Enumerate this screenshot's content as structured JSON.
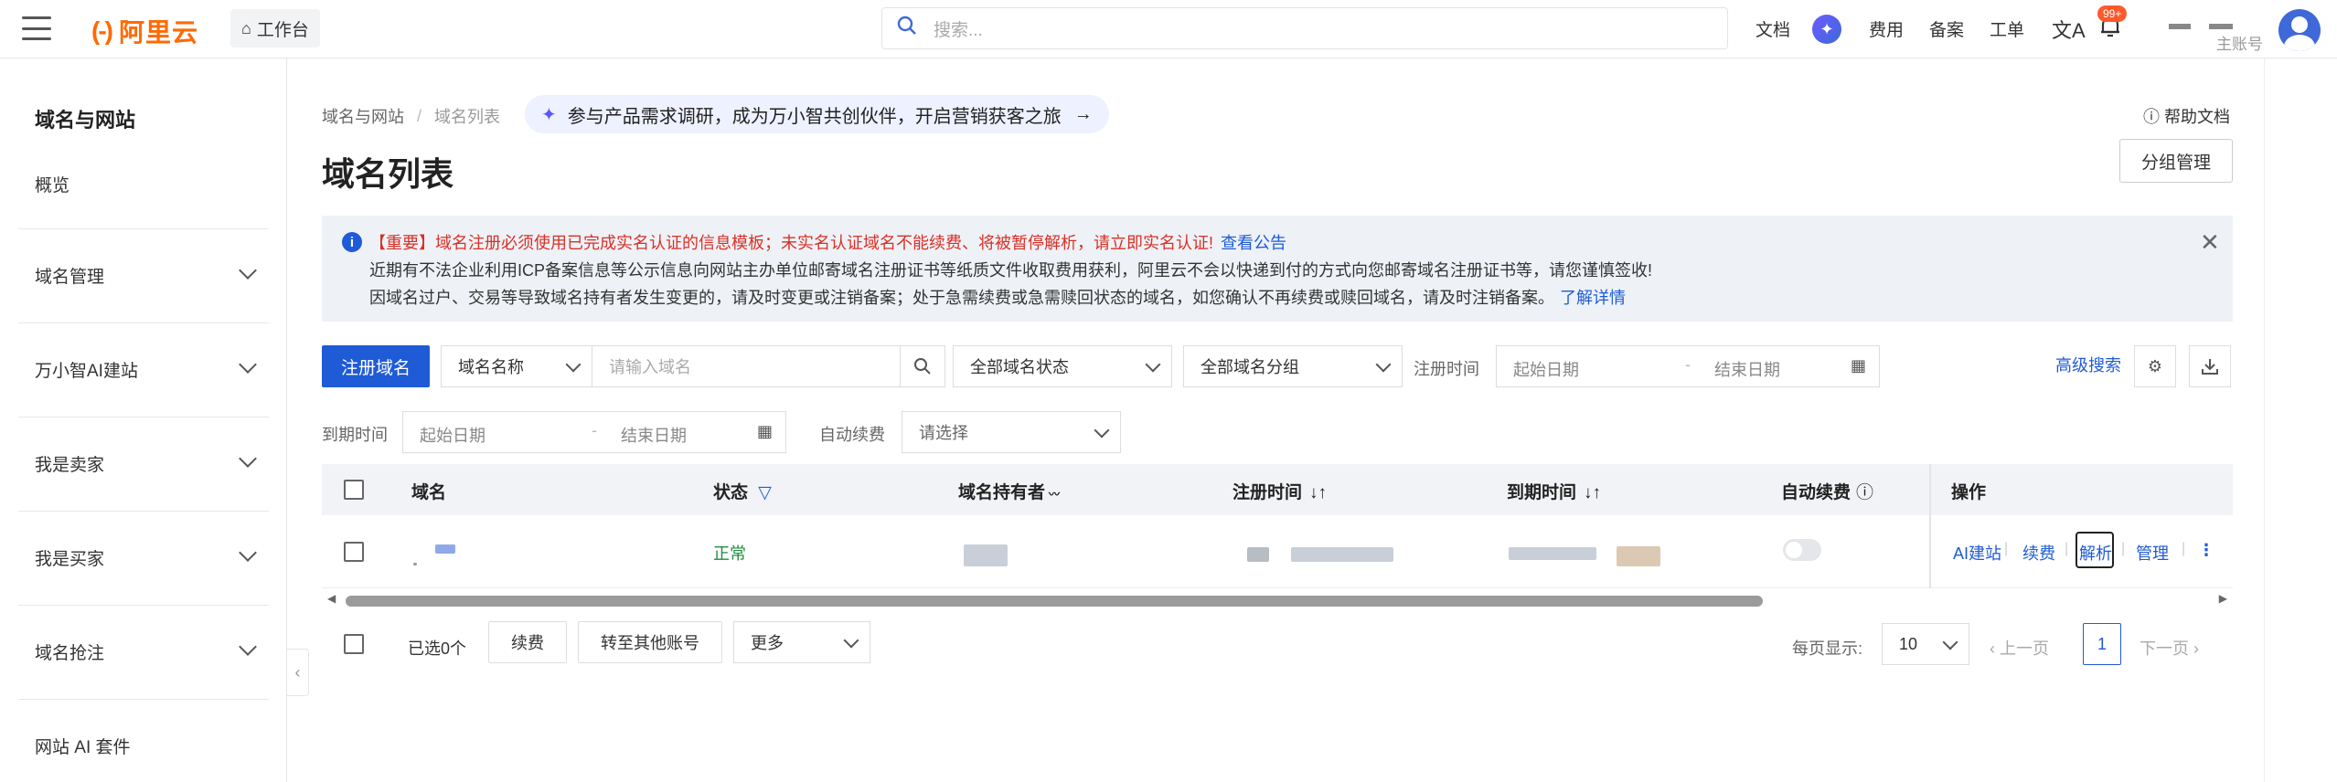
{
  "topbar": {
    "brand": "阿里云",
    "brand_mark": "(-)",
    "workbench": "工作台",
    "search_placeholder": "搜索...",
    "nav": [
      "文档",
      "费用",
      "备案",
      "工单"
    ],
    "notification_badge": "99+",
    "account_label": "主账号"
  },
  "sidebar": {
    "title": "域名与网站",
    "overview": "概览",
    "items": [
      "域名管理",
      "万小智AI建站",
      "我是卖家",
      "我是买家",
      "域名抢注",
      "网站 AI 套件"
    ]
  },
  "breadcrumb": [
    "域名与网站",
    "域名列表"
  ],
  "promo": "参与产品需求调研，成为万小智共创伙伴，开启营销获客之旅",
  "help_doc": "帮助文档",
  "page_title": "域名列表",
  "group_manage": "分组管理",
  "notice": {
    "important": "【重要】域名注册必须使用已完成实名认证的信息模板；未实名认证域名不能续费、将被暂停解析，请立即实名认证!",
    "important_link": "查看公告",
    "line2": "近期有不法企业利用ICP备案信息等公示信息向网站主办单位邮寄域名注册证书等纸质文件收取费用获利，阿里云不会以快递到付的方式向您邮寄域名注册证书等，请您谨慎签收!",
    "line3": "因域名过户、交易等导致域名持有者发生变更的，请及时变更或注销备案；处于急需续费或急需赎回状态的域名，如您确认不再续费或赎回域名，请及时注销备案。",
    "line3_link": "了解详情"
  },
  "filters": {
    "register_button": "注册域名",
    "field_select": "域名名称",
    "domain_placeholder": "请输入域名",
    "status_select": "全部域名状态",
    "group_select": "全部域名分组",
    "reg_time_label": "注册时间",
    "start_date": "起始日期",
    "end_date": "结束日期",
    "advanced_search": "高级搜索",
    "expire_label": "到期时间",
    "auto_renew_label": "自动续费",
    "auto_renew_placeholder": "请选择"
  },
  "table": {
    "headers": [
      "域名",
      "状态",
      "域名持有者",
      "注册时间",
      "到期时间",
      "自动续费",
      "操作"
    ],
    "rows": [
      {
        "status": "正常",
        "auto_renew": false,
        "actions": [
          "AI建站",
          "续费",
          "解析",
          "管理"
        ]
      }
    ]
  },
  "footer": {
    "selected": "已选0个",
    "renew": "续费",
    "transfer": "转至其他账号",
    "more": "更多",
    "per_page_label": "每页显示:",
    "per_page": "10",
    "prev": "上一页",
    "page": "1",
    "next": "下一页"
  },
  "colors": {
    "brand": "#ff6a00",
    "primary": "#1f5bd6",
    "danger": "#d93026",
    "success": "#1e8e3e"
  }
}
